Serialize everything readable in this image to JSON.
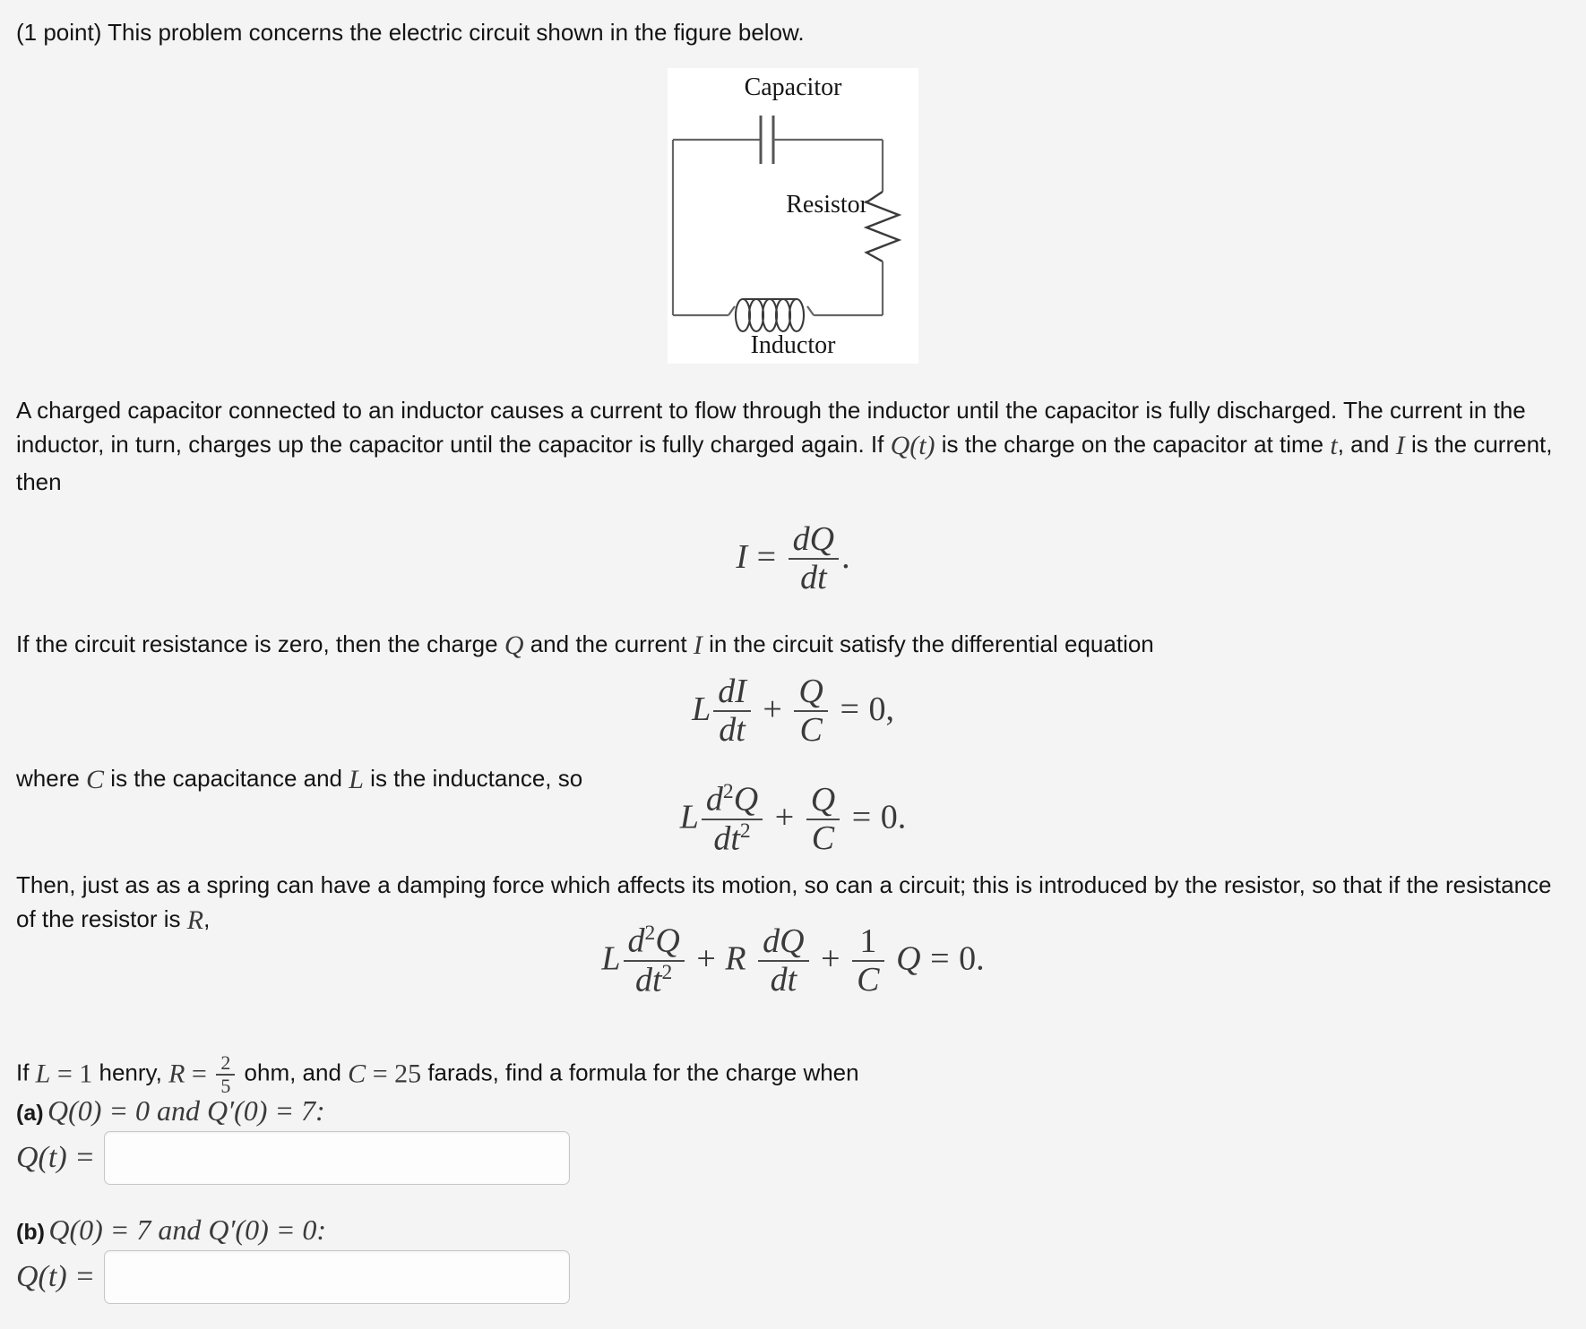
{
  "intro": {
    "text": "(1 point) This problem concerns the electric circuit shown in the figure below."
  },
  "figure": {
    "capacitor_label": "Capacitor",
    "resistor_label": "Resistor",
    "inductor_label": "Inductor"
  },
  "paragraphs": {
    "p1_a": "A charged capacitor connected to an inductor causes a current to flow through the inductor until the capacitor is fully discharged. The current in the inductor, in turn, charges up the capacitor until the capacitor is fully charged again. If ",
    "p1_qt": "Q(t)",
    "p1_b": " is the charge on the capacitor at time ",
    "p1_t": "t",
    "p1_c": ", and ",
    "p1_i": "I",
    "p1_d": " is the current, then",
    "p2_a": "If the circuit resistance is zero, then the charge ",
    "p2_q": "Q",
    "p2_b": " and the current ",
    "p2_i": "I",
    "p2_c": " in the circuit satisfy the differential equation",
    "p3_a": "where ",
    "p3_c": "C",
    "p3_b": " is the capacitance and ",
    "p3_l": "L",
    "p3_c2": " is the inductance, so",
    "p4_a": "Then, just as as a spring can have a damping force which affects its motion, so can a circuit; this is introduced by the resistor, so that if the resistance of the resistor is ",
    "p4_r": "R",
    "p4_b": ",",
    "p5_if": "If ",
    "p5_L": "L",
    "p5_eq1": " = ",
    "p5_Lval": "1",
    "p5_henry": " henry, ",
    "p5_R": "R",
    "p5_eq2": " = ",
    "p5_Rnum": "2",
    "p5_Rden": "5",
    "p5_ohm": " ohm, and ",
    "p5_C": "C",
    "p5_eq3": " = ",
    "p5_Cval": "25",
    "p5_farads": " farads, find a formula for the charge when"
  },
  "equations": {
    "eq_I": {
      "lhs": "I",
      "eq": "=",
      "num": "dQ",
      "den": "dt",
      "tail": "."
    },
    "eq_LdI": {
      "L": "L",
      "num": "dI",
      "den": "dt",
      "plus": "+",
      "qnum": "Q",
      "qden": "C",
      "eq": "=",
      "rhs": "0",
      "tail": ","
    },
    "eq_Ld2Q": {
      "L": "L",
      "num": "d",
      "num_sup": "2",
      "num_var": "Q",
      "den": "dt",
      "den_sup": "2",
      "plus": "+",
      "qnum": "Q",
      "qden": "C",
      "eq": "=",
      "rhs": "0",
      "tail": "."
    },
    "eq_full": {
      "L": "L",
      "num": "d",
      "num_sup": "2",
      "num_var": "Q",
      "den": "dt",
      "den_sup": "2",
      "plus1": "+",
      "R": "R",
      "num2": "dQ",
      "den2": "dt",
      "plus2": "+",
      "onenum": "1",
      "oneden": "C",
      "Q": "Q",
      "eq": "=",
      "rhs": "0",
      "tail": "."
    }
  },
  "answers": {
    "a": {
      "part": "(a)",
      "cond": "Q(0) = 0 and Q′(0) = 7:",
      "lhs": "Q(t) =",
      "value": "",
      "placeholder": ""
    },
    "b": {
      "part": "(b)",
      "cond": "Q(0) = 7 and Q′(0) = 0:",
      "lhs": "Q(t) =",
      "value": "",
      "placeholder": ""
    }
  },
  "colors": {
    "background": "#f4f4f4",
    "figure_background": "#ffffff",
    "text": "#141414",
    "math": "#3a3a3a",
    "wire": "#666666"
  }
}
